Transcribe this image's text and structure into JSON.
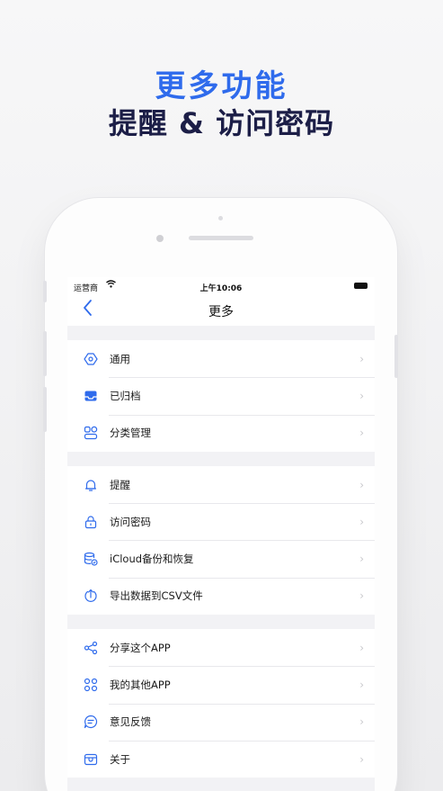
{
  "promo": {
    "headline": "更多功能",
    "subheadline": "提醒 & 访问密码"
  },
  "status_bar": {
    "carrier": "运营商",
    "time": "上午10:06"
  },
  "nav": {
    "title": "更多",
    "back_icon": "chevron-left-icon"
  },
  "groups": [
    {
      "items": [
        {
          "label": "通用",
          "icon": "general-settings-icon"
        },
        {
          "label": "已归档",
          "icon": "archive-tray-icon"
        },
        {
          "label": "分类管理",
          "icon": "category-icon"
        }
      ]
    },
    {
      "items": [
        {
          "label": "提醒",
          "icon": "bell-icon"
        },
        {
          "label": "访问密码",
          "icon": "lock-icon"
        },
        {
          "label": "iCloud备份和恢复",
          "icon": "database-backup-icon"
        },
        {
          "label": "导出数据到CSV文件",
          "icon": "export-icon"
        }
      ]
    },
    {
      "items": [
        {
          "label": "分享这个APP",
          "icon": "share-icon"
        },
        {
          "label": "我的其他APP",
          "icon": "apps-grid-icon"
        },
        {
          "label": "意见反馈",
          "icon": "feedback-icon"
        },
        {
          "label": "关于",
          "icon": "about-icon"
        }
      ]
    }
  ],
  "colors": {
    "accent": "#2f6bec",
    "headline_dark": "#1c1e47",
    "separator": "#e8e8ec",
    "background": "#f2f2f5"
  }
}
